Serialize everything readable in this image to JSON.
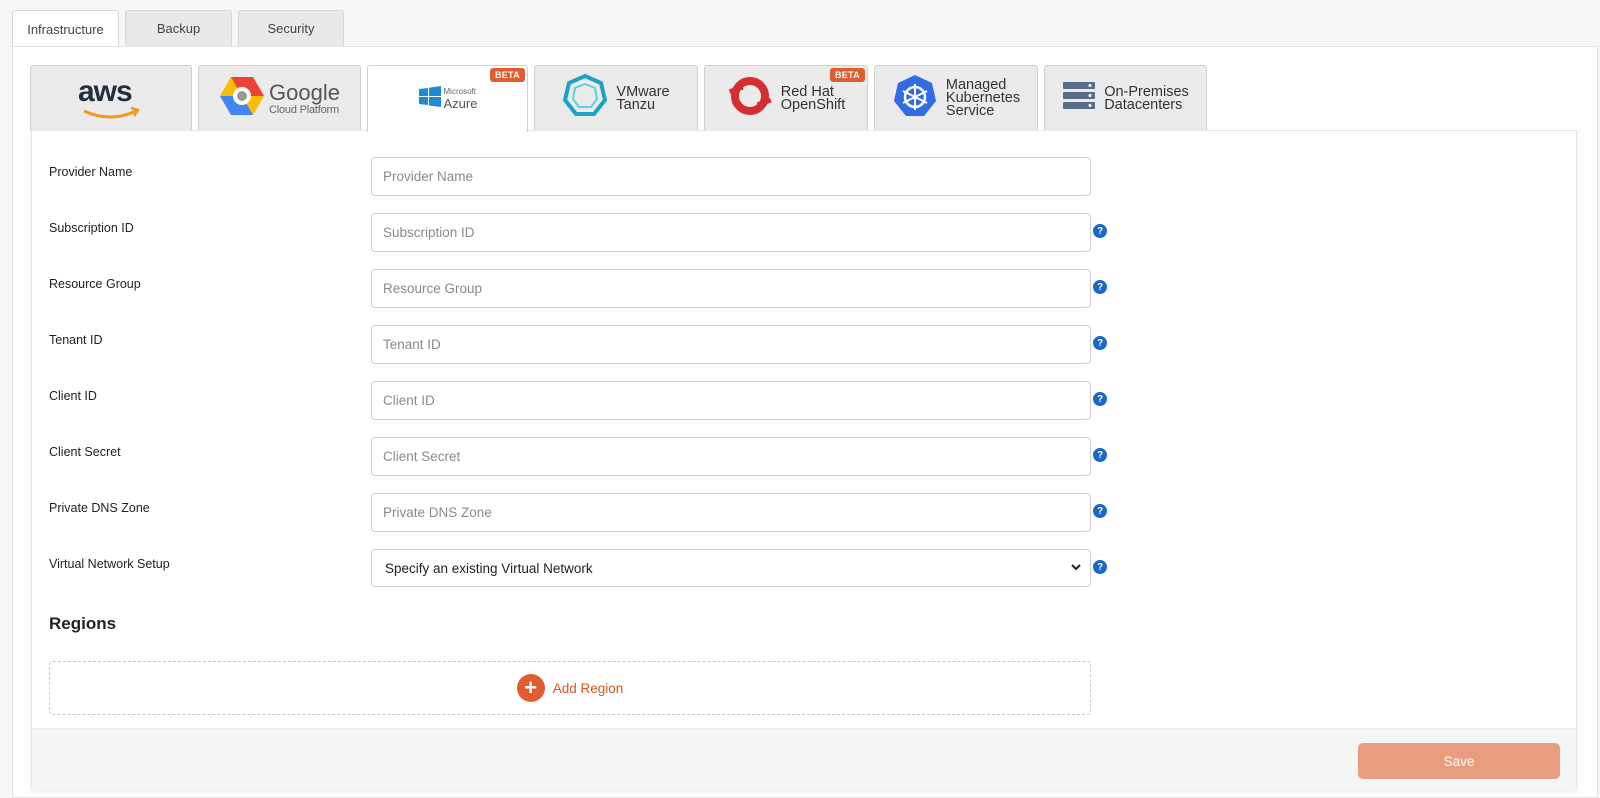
{
  "top_tabs": [
    {
      "label": "Infrastructure",
      "active": true
    },
    {
      "label": "Backup",
      "active": false
    },
    {
      "label": "Security",
      "active": false
    }
  ],
  "providers": [
    {
      "name": "aws",
      "label": "aws",
      "active": false
    },
    {
      "name": "google",
      "label": "Google",
      "sublabel": "Cloud Platform",
      "active": false
    },
    {
      "name": "azure",
      "label": "Azure",
      "sublabel": "Microsoft",
      "active": true,
      "badge": "BETA"
    },
    {
      "name": "vmware",
      "label": "VMware",
      "sublabel": "Tanzu",
      "active": false
    },
    {
      "name": "openshift",
      "label": "Red Hat",
      "sublabel": "OpenShift",
      "active": false,
      "badge": "BETA"
    },
    {
      "name": "mks",
      "label": "Managed",
      "line2": "Kubernetes",
      "line3": "Service",
      "active": false
    },
    {
      "name": "onprem",
      "label": "On-Premises",
      "sublabel": "Datacenters",
      "active": false
    }
  ],
  "form": {
    "fields": [
      {
        "label": "Provider Name",
        "placeholder": "Provider Name",
        "help": false
      },
      {
        "label": "Subscription ID",
        "placeholder": "Subscription ID",
        "help": true
      },
      {
        "label": "Resource Group",
        "placeholder": "Resource Group",
        "help": true
      },
      {
        "label": "Tenant ID",
        "placeholder": "Tenant ID",
        "help": true
      },
      {
        "label": "Client ID",
        "placeholder": "Client ID",
        "help": true
      },
      {
        "label": "Client Secret",
        "placeholder": "Client Secret",
        "help": true
      },
      {
        "label": "Private DNS Zone",
        "placeholder": "Private DNS Zone",
        "help": true
      }
    ],
    "vnet": {
      "label": "Virtual Network Setup",
      "value": "Specify an existing Virtual Network"
    },
    "help_glyph": "?"
  },
  "regions": {
    "title": "Regions",
    "add_label": "Add Region",
    "add_glyph": "+"
  },
  "footer": {
    "save_label": "Save"
  },
  "colors": {
    "accent": "#e05d2f",
    "help": "#1f66c9",
    "save": "#e99d80"
  }
}
